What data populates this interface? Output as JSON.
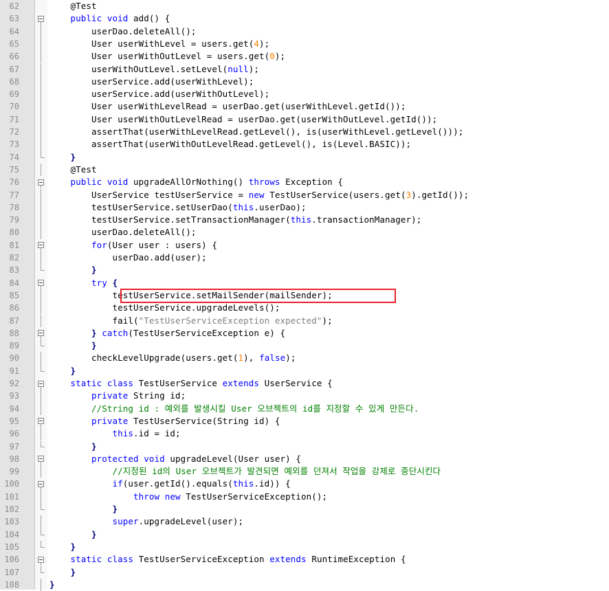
{
  "editor": {
    "highlight_color": "#e8202a",
    "lines": [
      {
        "n": "62",
        "tokens": [
          [
            "ann",
            "    @Test"
          ]
        ]
      },
      {
        "n": "63",
        "fold": "open",
        "tokens": [
          [
            "kw",
            "    public void"
          ],
          [
            "t",
            " add() {"
          ]
        ]
      },
      {
        "n": "64",
        "tokens": [
          [
            "t",
            "        userDao.deleteAll();"
          ]
        ]
      },
      {
        "n": "65",
        "tokens": [
          [
            "t",
            "        User userWithLevel = users.get("
          ],
          [
            "num",
            "4"
          ],
          [
            "t",
            ");"
          ]
        ]
      },
      {
        "n": "66",
        "tokens": [
          [
            "t",
            "        User userWithOutLevel = users.get("
          ],
          [
            "num",
            "0"
          ],
          [
            "t",
            ");"
          ]
        ]
      },
      {
        "n": "67",
        "tokens": [
          [
            "t",
            "        userWithOutLevel.setLevel("
          ],
          [
            "kw",
            "null"
          ],
          [
            "t",
            ");"
          ]
        ]
      },
      {
        "n": "68",
        "tokens": [
          [
            "t",
            "        userService.add(userWithLevel);"
          ]
        ]
      },
      {
        "n": "69",
        "tokens": [
          [
            "t",
            "        userService.add(userWithOutLevel);"
          ]
        ]
      },
      {
        "n": "70",
        "tokens": [
          [
            "t",
            "        User userWithLevelRead = userDao.get(userWithLevel.getId());"
          ]
        ]
      },
      {
        "n": "71",
        "tokens": [
          [
            "t",
            "        User userWithOutLevelRead = userDao.get(userWithOutLevel.getId());"
          ]
        ]
      },
      {
        "n": "72",
        "tokens": [
          [
            "t",
            "        assertThat(userWithLevelRead.getLevel(), is(userWithLevel.getLevel()));"
          ]
        ]
      },
      {
        "n": "73",
        "tokens": [
          [
            "t",
            "        assertThat(userWithOutLevelRead.getLevel(), is(Level.BASIC));"
          ]
        ]
      },
      {
        "n": "74",
        "fold": "end",
        "tokens": [
          [
            "op",
            "    }"
          ]
        ]
      },
      {
        "n": "75",
        "tokens": [
          [
            "ann",
            "    @Test"
          ]
        ]
      },
      {
        "n": "76",
        "fold": "open",
        "tokens": [
          [
            "kw",
            "    public void"
          ],
          [
            "t",
            " upgradeAllOrNothing() "
          ],
          [
            "kw",
            "throws"
          ],
          [
            "t",
            " Exception {"
          ]
        ]
      },
      {
        "n": "77",
        "tokens": [
          [
            "t",
            "        UserService testUserService = "
          ],
          [
            "kw",
            "new"
          ],
          [
            "t",
            " TestUserService(users.get("
          ],
          [
            "num",
            "3"
          ],
          [
            "t",
            ").getId());"
          ]
        ]
      },
      {
        "n": "78",
        "tokens": [
          [
            "t",
            "        testUserService.setUserDao("
          ],
          [
            "kw",
            "this"
          ],
          [
            "t",
            ".userDao);"
          ]
        ]
      },
      {
        "n": "79",
        "tokens": [
          [
            "t",
            "        testUserService.setTransactionManager("
          ],
          [
            "kw",
            "this"
          ],
          [
            "t",
            ".transactionManager);"
          ]
        ]
      },
      {
        "n": "80",
        "tokens": [
          [
            "t",
            "        userDao.deleteAll();"
          ]
        ]
      },
      {
        "n": "81",
        "fold": "open",
        "tokens": [
          [
            "kw",
            "        for"
          ],
          [
            "t",
            "(User user : users) {"
          ]
        ]
      },
      {
        "n": "82",
        "tokens": [
          [
            "t",
            "            userDao.add(user);"
          ]
        ]
      },
      {
        "n": "83",
        "fold": "end",
        "tokens": [
          [
            "op",
            "        }"
          ]
        ]
      },
      {
        "n": "84",
        "fold": "open",
        "tokens": [
          [
            "kw",
            "        try"
          ],
          [
            "op",
            " {"
          ]
        ]
      },
      {
        "n": "85",
        "tokens": [
          [
            "t",
            "            testUserService.setMailSender(mailSender);"
          ]
        ]
      },
      {
        "n": "86",
        "tokens": [
          [
            "t",
            "            testUserService.upgradeLevels();"
          ]
        ]
      },
      {
        "n": "87",
        "tokens": [
          [
            "t",
            "            fail("
          ],
          [
            "str",
            "\"TestUserServiceException expected\""
          ],
          [
            "t",
            ");"
          ]
        ]
      },
      {
        "n": "88",
        "fold": "open",
        "tokens": [
          [
            "op",
            "        }"
          ],
          [
            "kw",
            " catch"
          ],
          [
            "t",
            "(TestUserServiceException e) {"
          ]
        ]
      },
      {
        "n": "89",
        "fold": "end",
        "tokens": [
          [
            "op",
            "        }"
          ]
        ]
      },
      {
        "n": "90",
        "tokens": [
          [
            "t",
            "        checkLevelUpgrade(users.get("
          ],
          [
            "num",
            "1"
          ],
          [
            "t",
            "), "
          ],
          [
            "kw",
            "false"
          ],
          [
            "t",
            ");"
          ]
        ]
      },
      {
        "n": "91",
        "fold": "end",
        "tokens": [
          [
            "op",
            "    }"
          ]
        ]
      },
      {
        "n": "92",
        "fold": "open",
        "tokens": [
          [
            "kw",
            "    static class"
          ],
          [
            "t",
            " TestUserService "
          ],
          [
            "kw",
            "extends"
          ],
          [
            "t",
            " UserService {"
          ]
        ]
      },
      {
        "n": "93",
        "tokens": [
          [
            "kw",
            "        private"
          ],
          [
            "t",
            " String id;"
          ]
        ]
      },
      {
        "n": "94",
        "tokens": [
          [
            "cmt",
            "        //String id : 예외를 발생시킬 User 오브젝트의 id를 지정할 수 있게 만든다."
          ]
        ]
      },
      {
        "n": "95",
        "fold": "open",
        "tokens": [
          [
            "kw",
            "        private"
          ],
          [
            "t",
            " TestUserService(String id) {"
          ]
        ]
      },
      {
        "n": "96",
        "tokens": [
          [
            "kw",
            "            this"
          ],
          [
            "t",
            ".id = id;"
          ]
        ]
      },
      {
        "n": "97",
        "fold": "end",
        "tokens": [
          [
            "op",
            "        }"
          ]
        ]
      },
      {
        "n": "98",
        "fold": "open",
        "tokens": [
          [
            "kw",
            "        protected void"
          ],
          [
            "t",
            " upgradeLevel(User user) {"
          ]
        ]
      },
      {
        "n": "99",
        "tokens": [
          [
            "cmt",
            "            //지정된 id의 User 오브젝트가 발견되면 예외를 던져서 작업을 강제로 중단시킨다"
          ]
        ]
      },
      {
        "n": "100",
        "fold": "open",
        "tokens": [
          [
            "kw",
            "            if"
          ],
          [
            "t",
            "(user.getId().equals("
          ],
          [
            "kw",
            "this"
          ],
          [
            "t",
            ".id)) {"
          ]
        ]
      },
      {
        "n": "101",
        "tokens": [
          [
            "kw",
            "                throw new"
          ],
          [
            "t",
            " TestUserServiceException();"
          ]
        ]
      },
      {
        "n": "102",
        "fold": "end",
        "tokens": [
          [
            "op",
            "            }"
          ]
        ]
      },
      {
        "n": "103",
        "tokens": [
          [
            "kw",
            "            super"
          ],
          [
            "t",
            ".upgradeLevel(user);"
          ]
        ]
      },
      {
        "n": "104",
        "fold": "end",
        "tokens": [
          [
            "op",
            "        }"
          ]
        ]
      },
      {
        "n": "105",
        "fold": "end",
        "tokens": [
          [
            "op",
            "    }"
          ]
        ]
      },
      {
        "n": "106",
        "fold": "open",
        "tokens": [
          [
            "kw",
            "    static class"
          ],
          [
            "t",
            " TestUserServiceException "
          ],
          [
            "kw",
            "extends"
          ],
          [
            "t",
            " RuntimeException {"
          ]
        ]
      },
      {
        "n": "107",
        "fold": "end",
        "tokens": [
          [
            "op",
            "    }"
          ]
        ]
      },
      {
        "n": "108",
        "tokens": [
          [
            "op",
            "}"
          ]
        ]
      }
    ]
  }
}
